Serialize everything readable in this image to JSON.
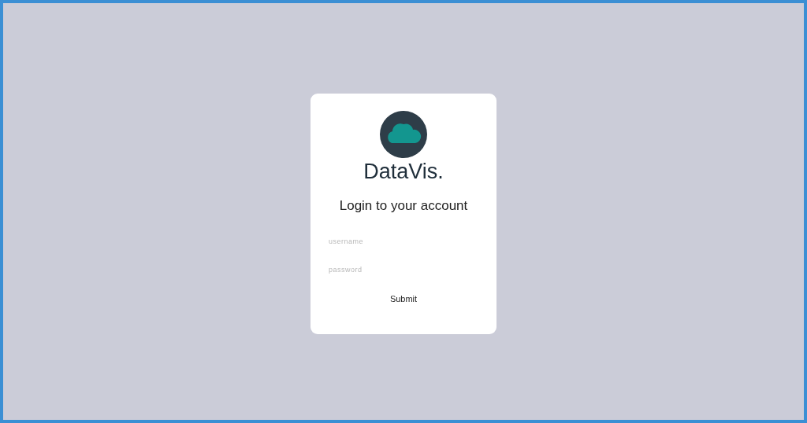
{
  "brand": "DataVis.",
  "heading": "Login to your account",
  "fields": [
    {
      "placeholder": "username"
    },
    {
      "placeholder": "password"
    }
  ],
  "button": "Submit"
}
